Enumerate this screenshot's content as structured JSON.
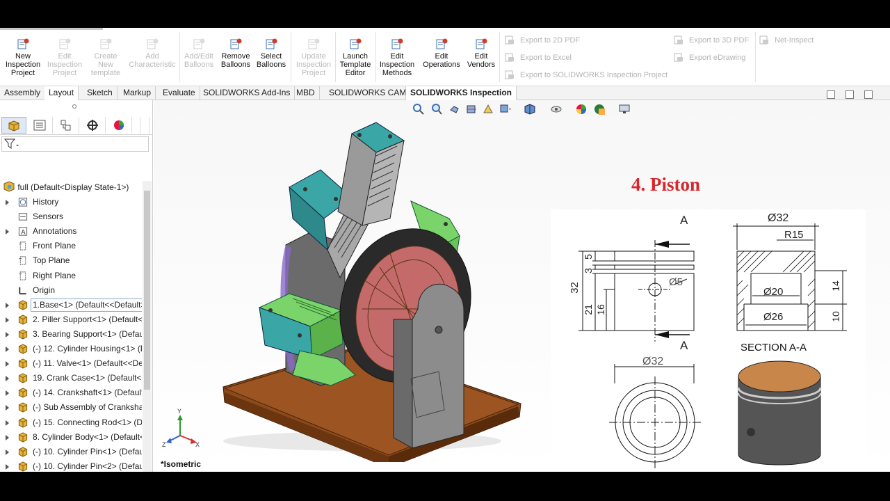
{
  "ribbon": {
    "buttons": [
      {
        "label": "New Inspection Project",
        "lines": [
          "New",
          "Inspection",
          "Project"
        ],
        "enabled": true
      },
      {
        "label": "Edit Inspection Project",
        "lines": [
          "Edit",
          "Inspection",
          "Project"
        ],
        "enabled": false
      },
      {
        "label": "Create New template",
        "lines": [
          "Create",
          "New",
          "template"
        ],
        "enabled": false
      },
      {
        "label": "Add Characteristic",
        "lines": [
          "Add",
          "Characteristic"
        ],
        "enabled": false
      },
      {
        "label": "Add/Edit Balloons",
        "lines": [
          "Add/Edit",
          "Balloons"
        ],
        "enabled": false
      },
      {
        "label": "Remove Balloons",
        "lines": [
          "Remove",
          "Balloons"
        ],
        "enabled": true
      },
      {
        "label": "Select Balloons",
        "lines": [
          "Select",
          "Balloons"
        ],
        "enabled": true
      },
      {
        "label": "Update Inspection Project",
        "lines": [
          "Update",
          "Inspection",
          "Project"
        ],
        "enabled": false
      },
      {
        "label": "Launch Template Editor",
        "lines": [
          "Launch",
          "Template",
          "Editor"
        ],
        "enabled": true
      },
      {
        "label": "Edit Inspection Methods",
        "lines": [
          "Edit",
          "Inspection",
          "Methods"
        ],
        "enabled": true
      },
      {
        "label": "Edit Operations",
        "lines": [
          "Edit",
          "Operations"
        ],
        "enabled": true
      },
      {
        "label": "Edit Vendors",
        "lines": [
          "Edit",
          "Vendors"
        ],
        "enabled": true
      }
    ],
    "export": {
      "to_2d_pdf": "Export to 2D PDF",
      "to_excel": "Export to Excel",
      "to_sw_project": "Export to SOLIDWORKS Inspection Project",
      "to_3d_pdf": "Export to 3D PDF",
      "edrawing": "Export eDrawing",
      "net_inspect": "Net-Inspect"
    }
  },
  "tabs": [
    "Assembly",
    "Layout",
    "Sketch",
    "Markup",
    "Evaluate",
    "SOLIDWORKS Add-Ins",
    "MBD",
    "SOLIDWORKS CAM",
    "SOLIDWORKS Inspection"
  ],
  "tree": {
    "root": "full  (Default<Display State-1>)",
    "items": [
      {
        "label": "History",
        "icon": "history-icon",
        "expand": true
      },
      {
        "label": "Sensors",
        "icon": "sensors-icon",
        "expand": false
      },
      {
        "label": "Annotations",
        "icon": "annotations-icon",
        "expand": true
      },
      {
        "label": "Front Plane",
        "icon": "plane-icon",
        "expand": false
      },
      {
        "label": "Top Plane",
        "icon": "plane-icon",
        "expand": false
      },
      {
        "label": "Right Plane",
        "icon": "plane-icon",
        "expand": false
      },
      {
        "label": "Origin",
        "icon": "origin-icon",
        "expand": false
      },
      {
        "label": "1.Base<1> (Default<<Default>",
        "icon": "part-icon",
        "expand": true,
        "selected": true
      },
      {
        "label": "2. Piller Support<1> (Default<",
        "icon": "part-icon",
        "expand": true
      },
      {
        "label": "3. Bearing Support<1> (Defaul",
        "icon": "part-icon",
        "expand": true
      },
      {
        "label": "(-) 12. Cylinder Housing<1> (D",
        "icon": "part-icon",
        "expand": true
      },
      {
        "label": "(-) 11. Valve<1> (Default<<Def",
        "icon": "part-icon",
        "expand": true
      },
      {
        "label": "19. Crank Case<1> (Default<<",
        "icon": "part-icon",
        "expand": true
      },
      {
        "label": "(-) 14. Crankshaft<1> (Default-",
        "icon": "part-icon",
        "expand": true
      },
      {
        "label": "(-) Sub Assembly of Crankshaf",
        "icon": "assembly-icon",
        "expand": true
      },
      {
        "label": "(-) 15. Connecting Rod<1> (De",
        "icon": "part-icon",
        "expand": true
      },
      {
        "label": "8. Cylinder Body<1> (Default<",
        "icon": "part-icon",
        "expand": true
      },
      {
        "label": "(-) 10. Cylinder Pin<1> (Defaul",
        "icon": "part-icon",
        "expand": true
      },
      {
        "label": "(-) 10. Cylinder Pin<2> (Defaul",
        "icon": "part-icon",
        "expand": true
      },
      {
        "label": "(-) 10. Cylinder Pin<3> (Defaul",
        "icon": "part-icon",
        "expand": true
      }
    ]
  },
  "viewport": {
    "view_label": "*Isometric",
    "drawing_title": "4. Piston",
    "dims": {
      "d32_top": "Ø32",
      "d5": "Ø5",
      "d32_bottom": "Ø32",
      "r15": "R15",
      "d20": "Ø20",
      "d26": "Ø26",
      "h5": "5",
      "h3": "3",
      "h32": "32",
      "h21": "21",
      "h16": "16",
      "h14": "14",
      "h10": "10",
      "sec_a_top": "A",
      "sec_a_bottom": "A",
      "section": "SECTION A-A"
    },
    "triad": {
      "x": "X",
      "y": "Y",
      "z": "Z"
    }
  },
  "colors": {
    "title_red": "#d8262c",
    "wood": "#8a4b1c",
    "teal": "#3aa6a6",
    "green": "#7bd46a"
  }
}
